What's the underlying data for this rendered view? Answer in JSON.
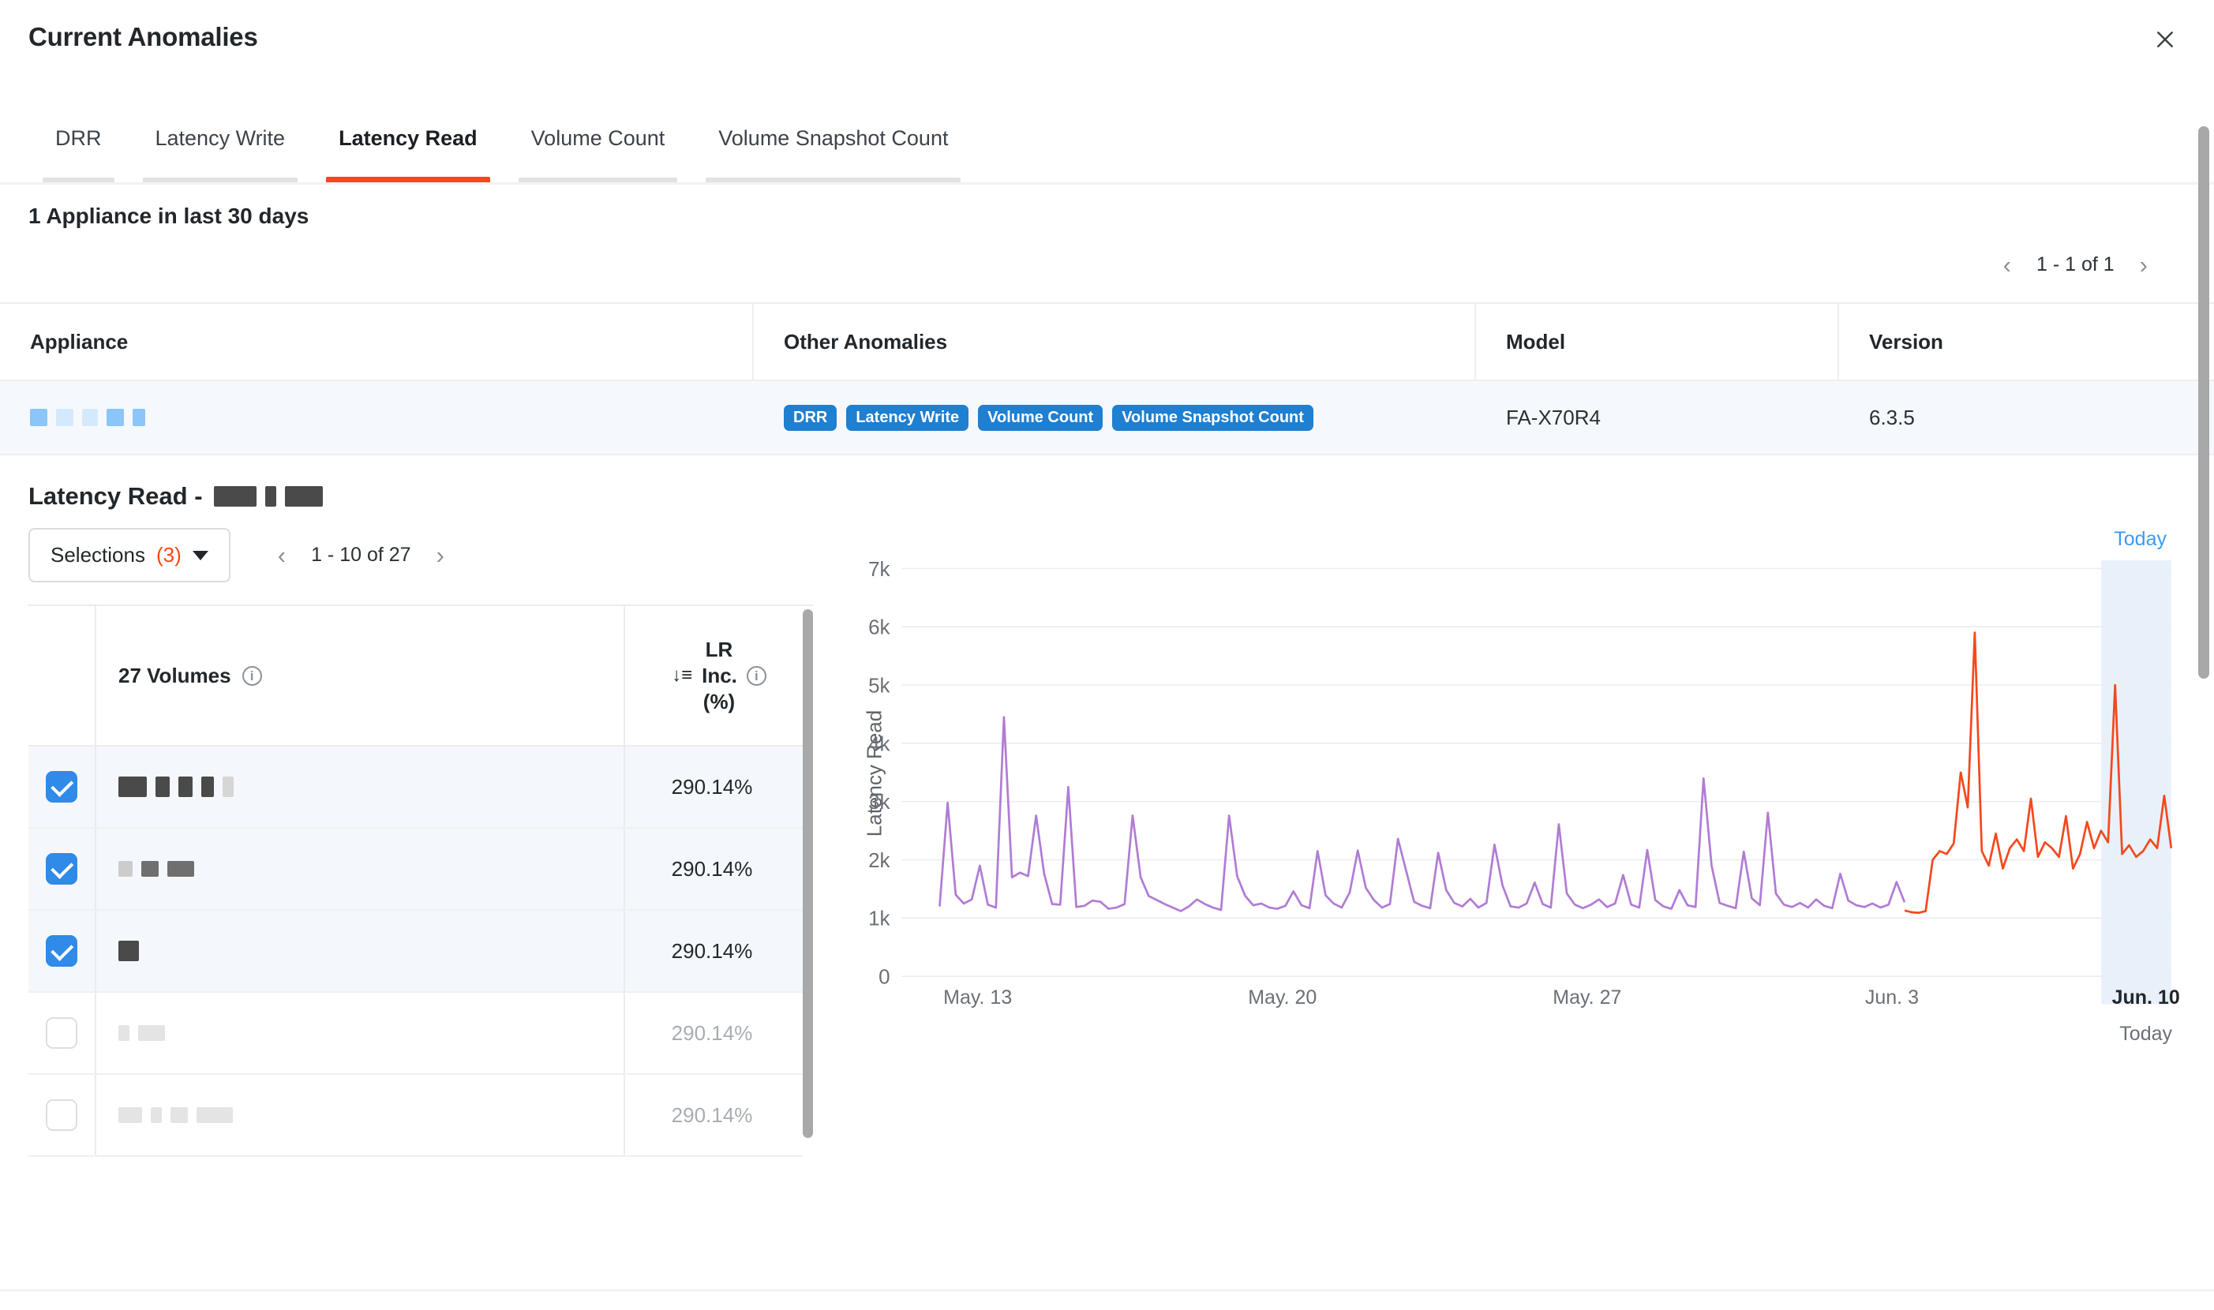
{
  "header": {
    "title": "Current Anomalies",
    "close_icon": "close-icon"
  },
  "tabs": [
    {
      "label": "DRR",
      "active": false
    },
    {
      "label": "Latency Write",
      "active": false
    },
    {
      "label": "Latency Read",
      "active": true
    },
    {
      "label": "Volume Count",
      "active": false
    },
    {
      "label": "Volume Snapshot Count",
      "active": false
    }
  ],
  "appliance_section": {
    "subtitle": "1 Appliance in last 30 days",
    "pagination": {
      "range": "1 - 1 of 1",
      "prev_icon": "chevron-left-icon",
      "next_icon": "chevron-right-icon"
    },
    "columns": [
      "Appliance",
      "Other Anomalies",
      "Model",
      "Version"
    ],
    "row": {
      "appliance_redacted": true,
      "other_anomalies": [
        "DRR",
        "Latency Write",
        "Volume Count",
        "Volume Snapshot Count"
      ],
      "model": "FA-X70R4",
      "version": "6.3.5"
    }
  },
  "latency_read_section": {
    "title_prefix": "Latency Read -",
    "selections_label": "Selections",
    "selections_count": "(3)",
    "pagination": {
      "range": "1 - 10 of 27",
      "prev_icon": "chevron-left-icon",
      "next_icon": "chevron-right-icon"
    },
    "table": {
      "volumes_header": "27 Volumes",
      "metric_header_line1": "LR",
      "metric_header_line2": "Inc.",
      "metric_header_line3": "(%)",
      "sort_icon": "sort-descending-icon",
      "info_icon": "info-icon",
      "rows": [
        {
          "selected": true,
          "value": "290.14%",
          "series_color": "#f5a06a",
          "redact": "dark-5"
        },
        {
          "selected": true,
          "value": "290.14%",
          "series_color": "#6cc6dd",
          "redact": "dark-3"
        },
        {
          "selected": true,
          "value": "290.14%",
          "series_color": "#a974d6",
          "redact": "dark-1"
        },
        {
          "selected": false,
          "value": "290.14%",
          "series_color": null,
          "redact": "faint-2"
        },
        {
          "selected": false,
          "value": "290.14%",
          "series_color": null,
          "redact": "faint-4"
        }
      ]
    }
  },
  "chart_data": {
    "type": "line",
    "title": "",
    "ylabel": "Latency Read",
    "xlabel": "",
    "ylim": [
      0,
      7000
    ],
    "yticks": [
      0,
      1000,
      2000,
      3000,
      4000,
      5000,
      6000,
      7000
    ],
    "ytick_labels": [
      "0",
      "1k",
      "2k",
      "3k",
      "4k",
      "5k",
      "6k",
      "7k"
    ],
    "xticks": [
      "May. 13",
      "May. 20",
      "May. 27",
      "Jun. 3",
      "Jun. 10"
    ],
    "xtick_positions": [
      0.06,
      0.3,
      0.54,
      0.78,
      0.98
    ],
    "today_label": "Today",
    "today_label_top": "Today",
    "grid": true,
    "legend": "none",
    "highlight_band": {
      "from": 0.945,
      "to": 1.0,
      "color": "#e8f1fa"
    },
    "series": [
      {
        "name": "volume-purple",
        "color": "#b07cd4",
        "baseline": 1200,
        "x_from": 0.03,
        "x_to": 0.79,
        "peaks_k": [
          3.0,
          4.45,
          3.25,
          2.75,
          2.8,
          2.6,
          2.7,
          3.4,
          2.8
        ],
        "values": [
          1200,
          2980,
          1400,
          1250,
          1320,
          1900,
          1230,
          1180,
          4450,
          1700,
          1780,
          1720,
          2760,
          1760,
          1240,
          1230,
          3250,
          1190,
          1210,
          1300,
          1280,
          1160,
          1180,
          1240,
          2760,
          1700,
          1380,
          1310,
          1240,
          1180,
          1120,
          1200,
          1320,
          1240,
          1180,
          1140,
          2760,
          1720,
          1380,
          1220,
          1250,
          1180,
          1160,
          1210,
          1460,
          1220,
          1170,
          2150,
          1390,
          1250,
          1180,
          1440,
          2160,
          1520,
          1310,
          1180,
          1240,
          2360,
          1820,
          1280,
          1210,
          1170,
          2120,
          1480,
          1260,
          1200,
          1330,
          1180,
          1260,
          2260,
          1560,
          1200,
          1180,
          1250,
          1610,
          1240,
          1180,
          2610,
          1420,
          1230,
          1170,
          1230,
          1320,
          1190,
          1250,
          1740,
          1230,
          1180,
          2170,
          1310,
          1200,
          1160,
          1480,
          1220,
          1190,
          3400,
          1900,
          1260,
          1210,
          1170,
          2140,
          1340,
          1220,
          2810,
          1420,
          1230,
          1190,
          1260,
          1180,
          1320,
          1210,
          1170,
          1760,
          1300,
          1220,
          1190,
          1250,
          1180,
          1230,
          1620,
          1270
        ]
      },
      {
        "name": "volume-orange-anomaly",
        "color": "#f4481d",
        "baseline": 1100,
        "x_from": 0.79,
        "x_to": 1.0,
        "peaks_k": [
          5.9,
          5.0,
          3.5,
          3.2,
          3.1
        ],
        "values": [
          1130,
          1100,
          1090,
          1120,
          2000,
          2150,
          2100,
          2280,
          3500,
          2900,
          5900,
          2150,
          1900,
          2450,
          1850,
          2200,
          2350,
          2150,
          3050,
          2050,
          2300,
          2200,
          2050,
          2750,
          1850,
          2100,
          2650,
          2200,
          2500,
          2300,
          5000,
          2100,
          2250,
          2050,
          2150,
          2350,
          2200,
          3100,
          2200
        ]
      }
    ]
  }
}
